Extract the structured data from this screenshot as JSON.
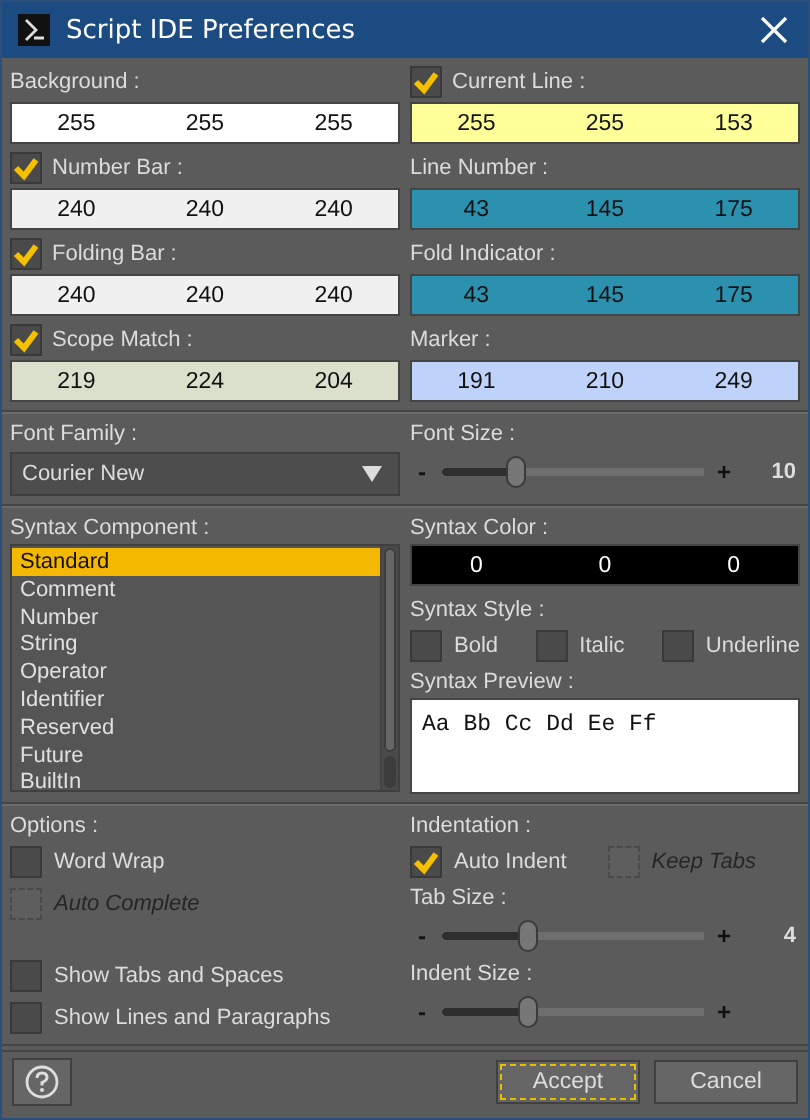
{
  "window": {
    "title": "Script IDE Preferences"
  },
  "color_settings": [
    {
      "kind": "plain",
      "label": "Background :",
      "color": "#ffffff",
      "values": [
        "255",
        "255",
        "255"
      ]
    },
    {
      "kind": "check",
      "label": "Current Line :",
      "checked": true,
      "color": "#ffff99",
      "values": [
        "255",
        "255",
        "153"
      ]
    },
    {
      "kind": "check",
      "label": "Number Bar :",
      "checked": true,
      "color": "#f0f0f0",
      "values": [
        "240",
        "240",
        "240"
      ]
    },
    {
      "kind": "plain",
      "label": "Line Number :",
      "color": "#2b91af",
      "values": [
        "43",
        "145",
        "175"
      ]
    },
    {
      "kind": "check",
      "label": "Folding Bar :",
      "checked": true,
      "color": "#f0f0f0",
      "values": [
        "240",
        "240",
        "240"
      ]
    },
    {
      "kind": "plain",
      "label": "Fold Indicator :",
      "color": "#2b91af",
      "values": [
        "43",
        "145",
        "175"
      ]
    },
    {
      "kind": "check",
      "label": "Scope Match :",
      "checked": true,
      "color": "#dbe0cc",
      "values": [
        "219",
        "224",
        "204"
      ]
    },
    {
      "kind": "plain",
      "label": "Marker :",
      "color": "#bfd2f9",
      "values": [
        "191",
        "210",
        "249"
      ]
    }
  ],
  "font_family": {
    "label": "Font Family :",
    "value": "Courier New"
  },
  "font_size": {
    "label": "Font Size :",
    "minus": "-",
    "plus": "+",
    "level": 0.28,
    "reading": "10"
  },
  "syntax_component": {
    "label": "Syntax Component :",
    "items": [
      {
        "label": "Standard",
        "selected": true
      },
      {
        "label": "Comment",
        "selected": false
      },
      {
        "label": "Number",
        "selected": false
      },
      {
        "label": "String",
        "selected": false
      },
      {
        "label": "Operator",
        "selected": false
      },
      {
        "label": "Identifier",
        "selected": false
      },
      {
        "label": "Reserved",
        "selected": false
      },
      {
        "label": "Future",
        "selected": false
      },
      {
        "label": "BuiltIn",
        "selected": false
      }
    ]
  },
  "syntax_color": {
    "label": "Syntax Color :",
    "color": "#000000",
    "values": [
      "0",
      "0",
      "0"
    ]
  },
  "syntax_style": {
    "label": "Syntax Style :",
    "options": [
      {
        "label": "Bold",
        "checked": false
      },
      {
        "label": "Italic",
        "checked": false
      },
      {
        "label": "Underline",
        "checked": false
      }
    ]
  },
  "syntax_preview": {
    "label": "Syntax Preview :",
    "text": "Aa Bb Cc Dd Ee Ff"
  },
  "options": {
    "label": "Options :",
    "items": [
      {
        "label": "Word Wrap",
        "checked": false,
        "disabled": false
      },
      {
        "label": "Auto Complete",
        "checked": false,
        "disabled": true
      },
      {
        "label": "Show Tabs and Spaces",
        "checked": false,
        "disabled": false
      },
      {
        "label": "Show Lines and Paragraphs",
        "checked": false,
        "disabled": false
      }
    ]
  },
  "indentation": {
    "label": "Indentation :",
    "items": [
      {
        "label": "Auto Indent",
        "checked": true,
        "disabled": false
      },
      {
        "label": "Keep Tabs",
        "checked": false,
        "disabled": true
      }
    ],
    "tab_size": {
      "label": "Tab Size :",
      "minus": "-",
      "plus": "+",
      "level": 0.33,
      "reading": "4"
    },
    "indent_size": {
      "label": "Indent Size :",
      "minus": "-",
      "plus": "+",
      "level": 0.33
    }
  },
  "buttons": {
    "accept": "Accept",
    "cancel": "Cancel"
  }
}
